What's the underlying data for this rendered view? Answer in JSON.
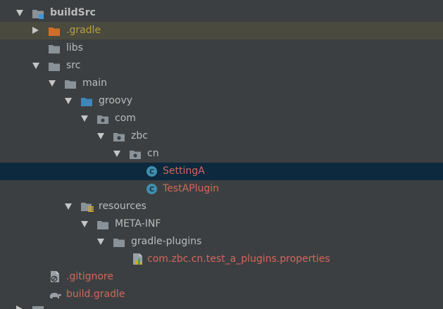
{
  "tree": {
    "build_src": "buildSrc",
    "gradle_dir": ".gradle",
    "libs": "libs",
    "src": "src",
    "main": "main",
    "groovy": "groovy",
    "com": "com",
    "zbc": "zbc",
    "cn": "cn",
    "setting_a": "SettingA",
    "test_a_plugin": "TestAPlugin",
    "resources": "resources",
    "meta_inf": "META-INF",
    "gradle_plugins": "gradle-plugins",
    "properties_file": "com.zbc.cn.test_a_plugins.properties",
    "gitignore": ".gitignore",
    "build_gradle": "build.gradle"
  },
  "icons": {
    "module": "module-folder-icon",
    "excluded_folder": "excluded-folder-icon",
    "folder": "folder-icon",
    "source_root": "source-root-folder-icon",
    "package": "package-icon",
    "groovy_class": "groovy-class-icon",
    "resources_root": "resources-root-folder-icon",
    "properties": "properties-file-icon",
    "ignore_file": "ignore-file-icon",
    "gradle_file": "gradle-elephant-icon"
  },
  "colors": {
    "background": "#3c3f41",
    "selected_row": "#0d293e",
    "ignored_row": "#4b4a3e",
    "ignored_text": "#b3a23f",
    "error_text": "#d5665c",
    "folder": "#8a9299",
    "excluded_folder": "#cf6e2a",
    "source_folder": "#3d87b9"
  }
}
